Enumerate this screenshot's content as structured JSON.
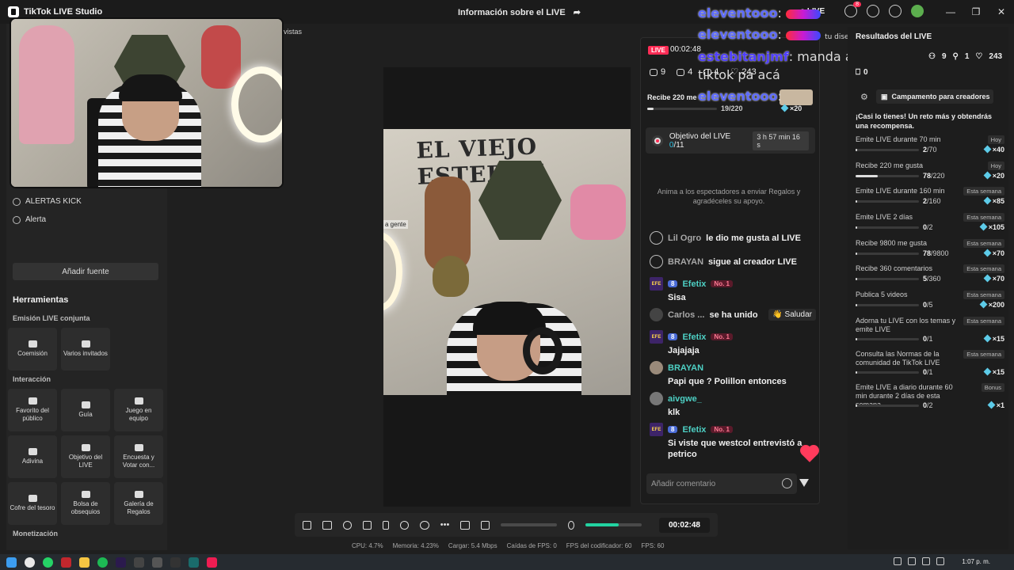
{
  "window": {
    "app_title": "TikTok LIVE Studio",
    "center_title": "Información sobre el LIVE",
    "live_label": "o LIVE",
    "notification_count": "8",
    "minimize": "—",
    "maximize": "❐",
    "close": "✕"
  },
  "scene_fragment": "vistas",
  "sources": [
    {
      "label": "ALERTAS KICK",
      "icon": "globe-icon"
    },
    {
      "label": "Alerta",
      "icon": "bell-icon"
    }
  ],
  "add_source_label": "Añadir fuente",
  "tools": {
    "title": "Herramientas",
    "sections": [
      {
        "title": "Emisión LIVE conjunta",
        "items": [
          "Coemisión",
          "Varios invitados"
        ]
      },
      {
        "title": "Interacción",
        "items": [
          "Favorito del público",
          "Guía",
          "Juego en equipo",
          "Adivina",
          "Objetivo del LIVE",
          "Encuesta y Votar con...",
          "Cofre del tesoro",
          "Bolsa de obsequios",
          "Galería de Regalos"
        ]
      },
      {
        "title": "Monetización",
        "items": []
      }
    ]
  },
  "preview": {
    "wall_text": "EL VIEJO ESTEBAN",
    "side_label": "a gente"
  },
  "overlay_chat": [
    {
      "name": "eleventooo",
      "text": ":",
      "suffix": "o LIVE"
    },
    {
      "name": "eleventooo",
      "text": ":",
      "suffix": "tu diseño"
    },
    {
      "name": "estebitanjmf",
      "text": ": manda a esa gente de"
    },
    {
      "name": "",
      "text": "tiktok pa acá"
    },
    {
      "name": "eleventooo",
      "text": ":"
    }
  ],
  "chat": {
    "live_badge": "LIVE",
    "elapsed": "00:02:48",
    "stats": {
      "viewers": "9",
      "views": "4",
      "gifters": "1",
      "likes": "243"
    },
    "goal": {
      "label": "Recibe 220 me",
      "progress": "19",
      "total": "/220",
      "progress_fraction": 0.086,
      "reward": "×20"
    },
    "objective": {
      "label": "Objetivo del LIVE",
      "value": "0",
      "total": "/11",
      "time_left": "3 h 57 min 16 s"
    },
    "hint": "Anima a los espectadores a enviar Regalos y agradéceles su apoyo.",
    "messages": [
      {
        "type": "event",
        "user": "Lil Ogro",
        "text": "le dio me gusta al LIVE"
      },
      {
        "type": "event",
        "user": "BRAYAN",
        "text": "sigue al creador LIVE"
      },
      {
        "type": "msg",
        "user": "Efetix",
        "level": "8",
        "rank": "No. 1",
        "text": "Sisa"
      },
      {
        "type": "join",
        "user": "Carlos ...",
        "text": "se ha unido",
        "action": "Saludar"
      },
      {
        "type": "msg",
        "user": "Efetix",
        "level": "8",
        "rank": "No. 1",
        "text": "Jajajaja"
      },
      {
        "type": "msg",
        "user": "BRAYAN",
        "text": "Papi que ? Polillon entonces"
      },
      {
        "type": "msg",
        "user": "aivgwe_",
        "text": "klk"
      },
      {
        "type": "msg",
        "user": "Efetix",
        "level": "8",
        "rank": "No. 1",
        "text": "Si viste que westcol entrevistó a petrico"
      }
    ],
    "comment_placeholder": "Añadir comentario"
  },
  "results": {
    "title": "Resultados del LIVE",
    "stats": [
      {
        "icon": "people-icon",
        "value": "9"
      },
      {
        "icon": "person-add-icon",
        "value": "1"
      },
      {
        "icon": "heart-icon",
        "value": "243"
      }
    ],
    "gifts": "0",
    "campaign_button": "Campamento para creadores",
    "challenge_text": "¡Casi lo tienes! Un reto más y obtendrás una recompensa.",
    "tasks": [
      {
        "name": "Emite LIVE durante 70 min",
        "tag": "Hoy",
        "done": "2",
        "total": "/70",
        "progress": 0.03,
        "reward": "×40"
      },
      {
        "name": "Recibe 220 me gusta",
        "tag": "Hoy",
        "done": "78",
        "total": "/220",
        "progress": 0.35,
        "reward": "×20"
      },
      {
        "name": "Emite LIVE durante 160 min",
        "tag": "Esta semana",
        "done": "2",
        "total": "/160",
        "progress": 0.013,
        "reward": "×85"
      },
      {
        "name": "Emite LIVE 2 días",
        "tag": "Esta semana",
        "done": "0",
        "total": "/2",
        "progress": 0,
        "reward": "×105"
      },
      {
        "name": "Recibe 9800 me gusta",
        "tag": "Esta semana",
        "done": "78",
        "total": "/9800",
        "progress": 0.008,
        "reward": "×70"
      },
      {
        "name": "Recibe 360 comentarios",
        "tag": "Esta semana",
        "done": "5",
        "total": "/360",
        "progress": 0.014,
        "reward": "×70"
      },
      {
        "name": "Publica 5 videos",
        "tag": "Esta semana",
        "done": "0",
        "total": "/5",
        "progress": 0,
        "reward": "×200"
      },
      {
        "name": "Adorna tu LIVE con los temas y emite LIVE",
        "tag": "Esta semana",
        "done": "0",
        "total": "/1",
        "progress": 0,
        "reward": "×15"
      },
      {
        "name": "Consulta las Normas de la comunidad de TikTok LIVE",
        "tag": "Esta semana",
        "done": "0",
        "total": "/1",
        "progress": 0,
        "reward": "×15"
      },
      {
        "name": "Emite LIVE a diario durante 60 min durante 2 días de esta semana",
        "tag": "Bonus",
        "done": "0",
        "total": "/2",
        "progress": 0,
        "reward": "×1"
      }
    ]
  },
  "controls": {
    "timer": "00:02:48",
    "volume_level": 0.6
  },
  "status": {
    "cpu": "CPU:  4.7%",
    "memory": "Memoria:  4.23%",
    "load": "Cargar:  5.4 Mbps",
    "fps_drops": "Caídas de FPS:  0",
    "encoder_fps": "FPS del codificador:  60",
    "fps": "FPS:  60"
  },
  "taskbar": {
    "time": "1:07 p. m."
  }
}
